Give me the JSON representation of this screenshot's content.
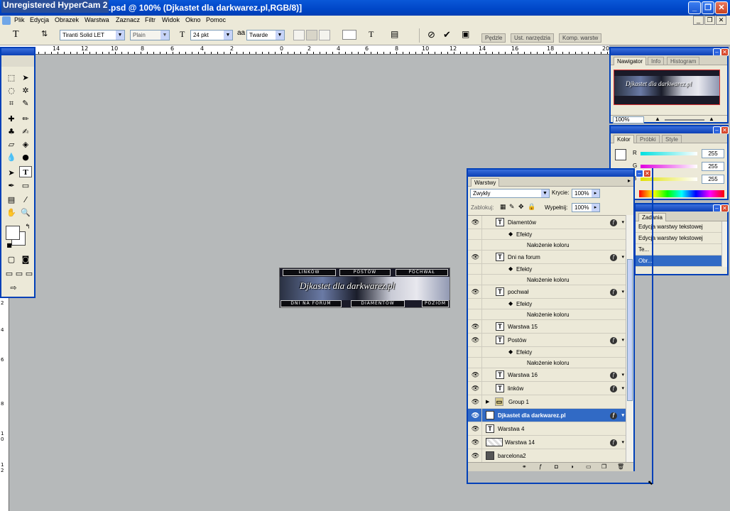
{
  "window": {
    "watermark": "Unregistered HyperCam 2",
    "title": "...an2al.psd @ 100% (Djkastet dla darkwarez.pl,RGB/8)]"
  },
  "menu": {
    "items": [
      "Plik",
      "Edycja",
      "Obrazek",
      "Warstwa",
      "Zaznacz",
      "Filtr",
      "Widok",
      "Okno",
      "Pomoc"
    ]
  },
  "options": {
    "font_family": "Tiranti Solid LET",
    "font_style": "Plain",
    "font_size": "24 pkt",
    "antialias": "Twarde",
    "tabs": [
      "Pędzle",
      "Ust. narzędzia",
      "Komp. warstw"
    ]
  },
  "rulers": {
    "h_ticks": [
      "14",
      "12",
      "10",
      "8",
      "6",
      "4",
      "2",
      "0",
      "2",
      "4",
      "6",
      "8",
      "10",
      "12",
      "14",
      "16",
      "18",
      "20"
    ],
    "v_ticks": [
      "2",
      "4",
      "6",
      "8",
      "10",
      "12"
    ]
  },
  "banner": {
    "nav_top": [
      "LINKÓW",
      "POSTÓW",
      "POCHWAŁ"
    ],
    "nav_bottom": [
      "DNI NA FORUM",
      "DIAMENTÓW",
      "POZIOM"
    ],
    "brand": "Djkastet dla darkwarez.pl"
  },
  "navigator": {
    "tabs": [
      "Nawigator",
      "Info",
      "Histogram"
    ],
    "zoom": "100%"
  },
  "color": {
    "tabs": [
      "Kolor",
      "Próbki",
      "Style"
    ],
    "channels": [
      {
        "label": "R",
        "value": "255",
        "color": "#00e0e0"
      },
      {
        "label": "G",
        "value": "255",
        "color": "#e000e0"
      },
      {
        "label": "B",
        "value": "255",
        "color": "#e0e000"
      }
    ]
  },
  "history": {
    "tab": "Zadania",
    "rows": [
      "Edycja warstwy tekstowej",
      "Edycja warstwy tekstowej",
      "Te...",
      "Obr..."
    ]
  },
  "layers": {
    "tab": "Warstwy",
    "blend_mode": "Zwykły",
    "opacity_label": "Krycie:",
    "opacity_value": "100%",
    "lock_label": "Zablokuj:",
    "fill_label": "Wypełnij:",
    "fill_value": "100%",
    "rows": [
      {
        "type": "text",
        "name": "Diamentów",
        "indent": 1,
        "fx": true
      },
      {
        "type": "effects",
        "name": "Efekty"
      },
      {
        "type": "effect",
        "name": "Nałożenie koloru"
      },
      {
        "type": "text",
        "name": "Dni na forum",
        "indent": 1,
        "fx": true
      },
      {
        "type": "effects",
        "name": "Efekty"
      },
      {
        "type": "effect",
        "name": "Nałożenie koloru"
      },
      {
        "type": "text",
        "name": "pochwał",
        "indent": 1,
        "fx": true
      },
      {
        "type": "effects",
        "name": "Efekty"
      },
      {
        "type": "effect",
        "name": "Nałożenie koloru"
      },
      {
        "type": "text",
        "name": "Warstwa 15",
        "indent": 1,
        "fx": false
      },
      {
        "type": "text",
        "name": "Postów",
        "indent": 1,
        "fx": true
      },
      {
        "type": "effects",
        "name": "Efekty"
      },
      {
        "type": "effect",
        "name": "Nałożenie koloru"
      },
      {
        "type": "text",
        "name": "Warstwa 16",
        "indent": 1,
        "fx": true
      },
      {
        "type": "text",
        "name": "linków",
        "indent": 1,
        "fx": true
      },
      {
        "type": "group",
        "name": "Group 1",
        "indent": 0,
        "fx": false
      },
      {
        "type": "text",
        "name": "Djkastet dla darkwarez.pl",
        "indent": 0,
        "fx": true,
        "selected": true
      },
      {
        "type": "text",
        "name": "Warstwa 4",
        "indent": 0,
        "fx": false
      },
      {
        "type": "pixel",
        "name": "Warstwa 14",
        "indent": 0,
        "fx": true
      },
      {
        "type": "image",
        "name": "barcelona2",
        "indent": 0,
        "fx": false
      }
    ]
  }
}
